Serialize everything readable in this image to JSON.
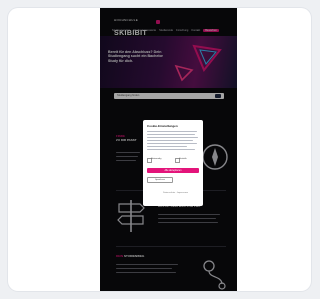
{
  "header": {
    "logo_small": "HOCHSCHULE",
    "logo_big": "SKIBIBIT",
    "nav": [
      "Studienangebot",
      "Studieninteressierte",
      "Studierende",
      "Forschung",
      "Kontakt",
      "Bewerben"
    ]
  },
  "hero": {
    "headline": "Bereit für den Abschluss? Dein Studiengang sucht ein Bachelor Study für dich."
  },
  "search": {
    "placeholder": "Studiengang finden"
  },
  "sections": [
    {
      "kicker": "FINDE",
      "title": "ZU DIR PASST"
    },
    {
      "kicker": "",
      "title": "DAS IST DEIN WEG ZUM ZIEL"
    },
    {
      "kicker": "DEIN",
      "title": "STUDIENWEG"
    }
  ],
  "modal": {
    "title": "Cookie-Einstellungen",
    "opt_necessary": "Notwendig",
    "opt_stats": "Statistik",
    "accept": "Alle akzeptieren",
    "save": "Speichern",
    "footer": "Datenschutz · Impressum"
  },
  "colors": {
    "accent": "#e3147a",
    "background": "#0c0c0f"
  }
}
